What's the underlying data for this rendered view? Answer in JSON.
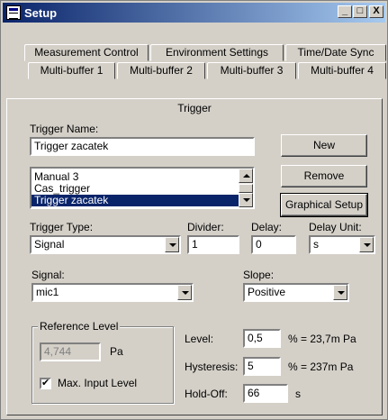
{
  "window": {
    "title": "Setup"
  },
  "controls": {
    "minimize": "_",
    "maximize": "□",
    "close": "X"
  },
  "tabs": {
    "row1": [
      "Measurement Control",
      "Environment Settings",
      "Time/Date Sync"
    ],
    "row2": [
      "Multi-buffer 1",
      "Multi-buffer 2",
      "Multi-buffer 3",
      "Multi-buffer 4"
    ],
    "active": "Trigger"
  },
  "trigger": {
    "name_label": "Trigger Name:",
    "name_value": "Trigger zacatek",
    "list": [
      "Manual 3",
      "Cas_trigger",
      "Trigger zacatek"
    ],
    "selected_index": 2,
    "new_button": "New",
    "remove_button": "Remove",
    "graphical_button": "Graphical Setup"
  },
  "type": {
    "type_label": "Trigger Type:",
    "type_value": "Signal",
    "divider_label": "Divider:",
    "divider_value": "1",
    "delay_label": "Delay:",
    "delay_value": "0",
    "delay_unit_label": "Delay Unit:",
    "delay_unit_value": "s"
  },
  "signal": {
    "signal_label": "Signal:",
    "signal_value": "mic1",
    "slope_label": "Slope:",
    "slope_value": "Positive"
  },
  "reference": {
    "group_label": "Reference Level",
    "value": "4,744",
    "unit": "Pa",
    "max_input_label": "Max. Input Level",
    "max_input_checked": "✔"
  },
  "level": {
    "level_label": "Level:",
    "level_value": "0,5",
    "level_suffix": "% = 23,7m Pa",
    "hysteresis_label": "Hysteresis:",
    "hysteresis_value": "5",
    "hysteresis_suffix": "% = 237m Pa",
    "holdoff_label": "Hold-Off:",
    "holdoff_value": "66",
    "holdoff_unit": "s"
  }
}
